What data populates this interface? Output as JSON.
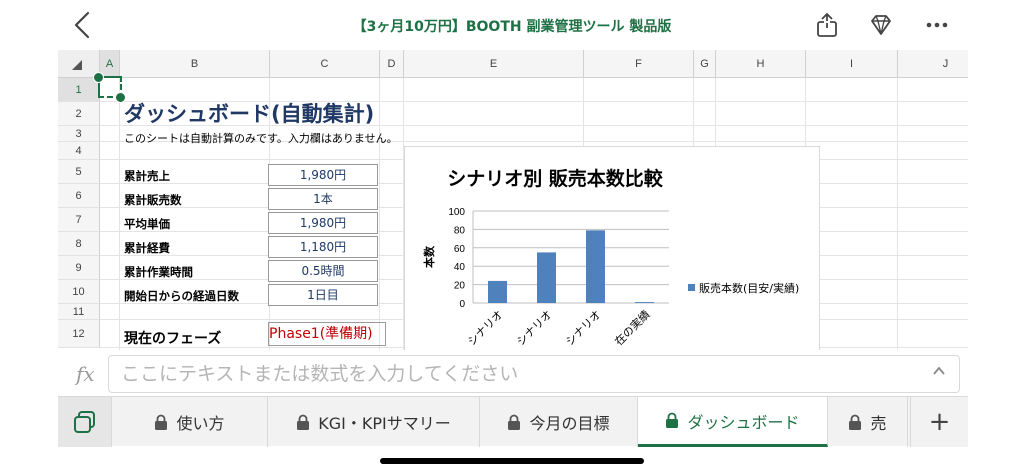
{
  "header": {
    "title": "【3ヶ月10万円】BOOTH 副業管理ツール 製品版",
    "back_icon": "chevron-left-icon",
    "share_icon": "share-icon",
    "premium_icon": "diamond-icon",
    "more_icon": "more-icon"
  },
  "columns": [
    "A",
    "B",
    "C",
    "D",
    "E",
    "F",
    "G",
    "H",
    "I",
    "J"
  ],
  "rows": [
    "1",
    "2",
    "3",
    "4",
    "5",
    "6",
    "7",
    "8",
    "9",
    "10",
    "11",
    "12"
  ],
  "dashboard": {
    "title": "ダッシュボード(自動集計)",
    "subtitle": "このシートは自動計算のみです。入力欄はありません。",
    "metrics": [
      {
        "label": "累計売上",
        "value": "1,980円"
      },
      {
        "label": "累計販売数",
        "value": "1本"
      },
      {
        "label": "平均単価",
        "value": "1,980円"
      },
      {
        "label": "累計経費",
        "value": "1,180円"
      },
      {
        "label": "累計作業時間",
        "value": "0.5時間"
      },
      {
        "label": "開始日からの経過日数",
        "value": "1日目"
      }
    ],
    "phase_label": "現在のフェーズ",
    "phase_value": "Phase1(準備期)"
  },
  "chart_data": {
    "type": "bar",
    "title": "シナリオ別 販売本数比較",
    "ylabel": "本数",
    "xlabel": "",
    "ylim": [
      0,
      100
    ],
    "yticks": [
      0,
      20,
      40,
      60,
      80,
      100
    ],
    "categories": [
      "シナリオ",
      "シナリオ",
      "シナリオ",
      "在の実績"
    ],
    "series": [
      {
        "name": "販売本数(目安/実績)",
        "values": [
          24,
          55,
          79,
          1
        ],
        "color": "#4f81bd"
      }
    ],
    "grid": true,
    "legend": "right"
  },
  "formula_bar": {
    "icon": "fx-icon",
    "placeholder": "ここにテキストまたは数式を入力してください"
  },
  "tabs": [
    {
      "label": "使い方",
      "locked": true,
      "active": false
    },
    {
      "label": "KGI・KPIサマリー",
      "locked": true,
      "active": false
    },
    {
      "label": "今月の目標",
      "locked": true,
      "active": false
    },
    {
      "label": "ダッシュボード",
      "locked": true,
      "active": true
    },
    {
      "label": "売",
      "locked": true,
      "active": false
    }
  ],
  "tabbar": {
    "sheets_icon": "sheets-list-icon",
    "add_label": "+"
  }
}
